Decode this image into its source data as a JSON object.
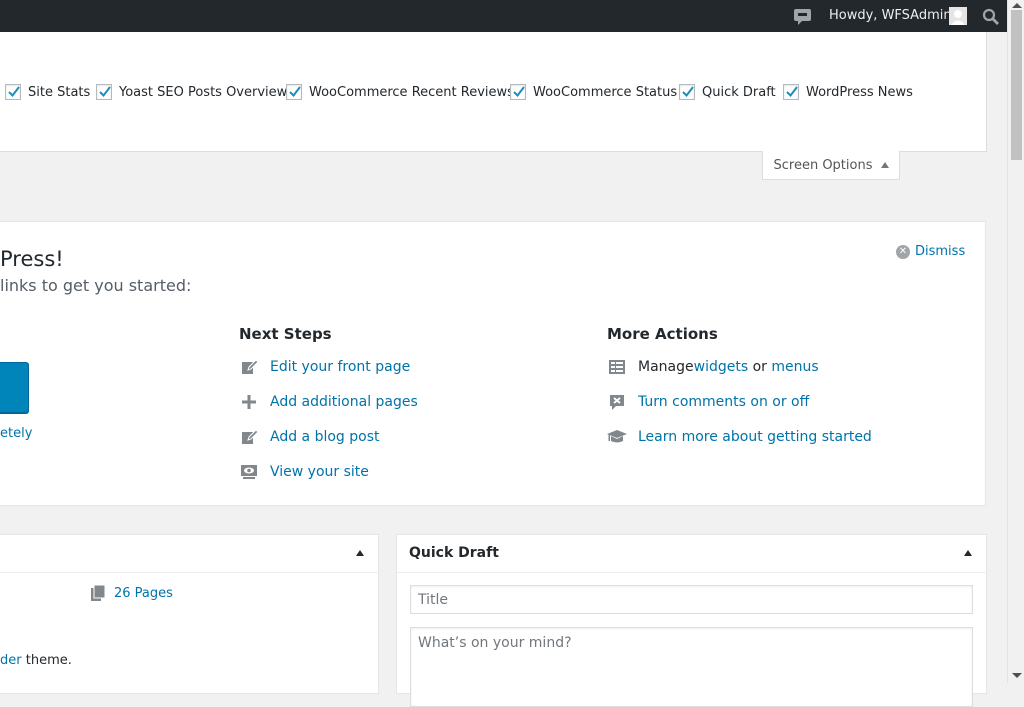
{
  "admin_bar": {
    "greeting": "Howdy, WFSAdmin",
    "icons": [
      "comment-icon",
      "avatar",
      "search-icon"
    ],
    "background": "#23282d"
  },
  "screen_options": {
    "checkboxes": [
      {
        "label": "Site Stats",
        "checked": true
      },
      {
        "label": "Yoast SEO Posts Overview",
        "checked": true
      },
      {
        "label": "WooCommerce Recent Reviews",
        "checked": true
      },
      {
        "label": "WooCommerce Status",
        "checked": true
      },
      {
        "label": "Quick Draft",
        "checked": true
      },
      {
        "label": "WordPress News",
        "checked": true
      }
    ],
    "tab_label": "Screen Options"
  },
  "welcome": {
    "title_fragment": "Press!",
    "about_fragment": "links to get you started:",
    "dismiss_label": "Dismiss",
    "completely_fragment": "etely",
    "next_steps": {
      "heading": "Next Steps",
      "items": [
        {
          "label": "Edit your front page",
          "icon": "edit-icon"
        },
        {
          "label": "Add additional pages",
          "icon": "plus-icon"
        },
        {
          "label": "Add a blog post",
          "icon": "edit-icon"
        },
        {
          "label": "View your site",
          "icon": "view-icon"
        }
      ]
    },
    "more_actions": {
      "heading": "More Actions",
      "manage_prefix": "Manage ",
      "widgets_label": "widgets",
      "or_label": " or ",
      "menus_label": "menus",
      "comments_label": "Turn comments on or off",
      "learn_label": "Learn more about getting started"
    }
  },
  "at_a_glance": {
    "pages_label": "26 Pages",
    "theme_link_fragment": "der",
    "theme_suffix": " theme."
  },
  "quick_draft": {
    "title": "Quick Draft",
    "title_placeholder": "Title",
    "content_placeholder": "What’s on your mind?"
  },
  "colors": {
    "link": "#0073aa",
    "primary_button": "#0085ba",
    "page_background": "#f1f1f1"
  }
}
